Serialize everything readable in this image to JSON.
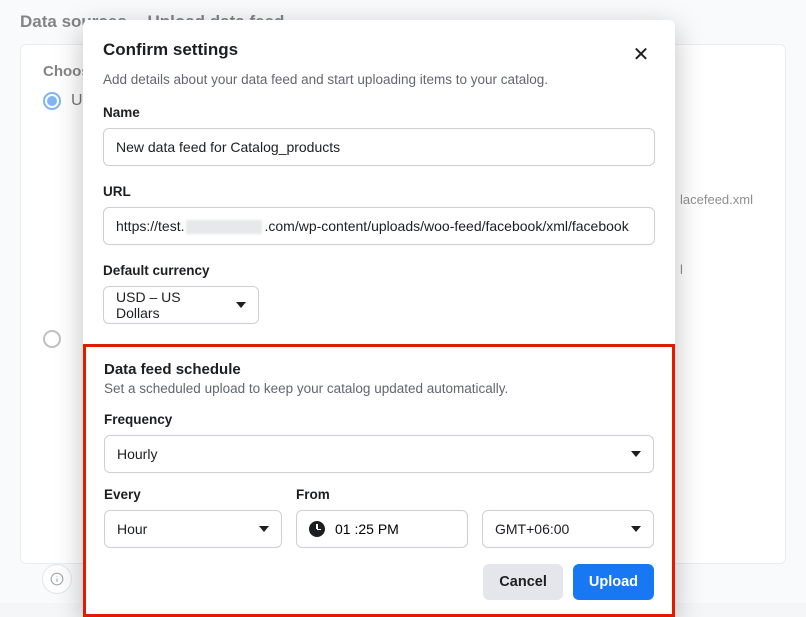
{
  "breadcrumb": {
    "root": "Data sources",
    "current": "Upload data feed"
  },
  "background": {
    "section_title": "Choos",
    "option1": "U",
    "url_fragment": "lacefeed.xml",
    "other_char": "l"
  },
  "modal": {
    "title": "Confirm settings",
    "subtitle": "Add details about your data feed and start uploading items to your catalog.",
    "name_label": "Name",
    "name_value": "New data feed for Catalog_products",
    "url_label": "URL",
    "url_start": "https://test.",
    "url_end": ".com/wp-content/uploads/woo-feed/facebook/xml/facebook",
    "currency_label": "Default currency",
    "currency_value": "USD – US Dollars",
    "schedule": {
      "title": "Data feed schedule",
      "subtitle": "Set a scheduled upload to keep your catalog updated automatically.",
      "frequency_label": "Frequency",
      "frequency_value": "Hourly",
      "every_label": "Every",
      "every_value": "Hour",
      "from_label": "From",
      "time_value": "01 :25 PM",
      "tz_value": "GMT+06:00"
    },
    "cancel": "Cancel",
    "upload": "Upload"
  }
}
